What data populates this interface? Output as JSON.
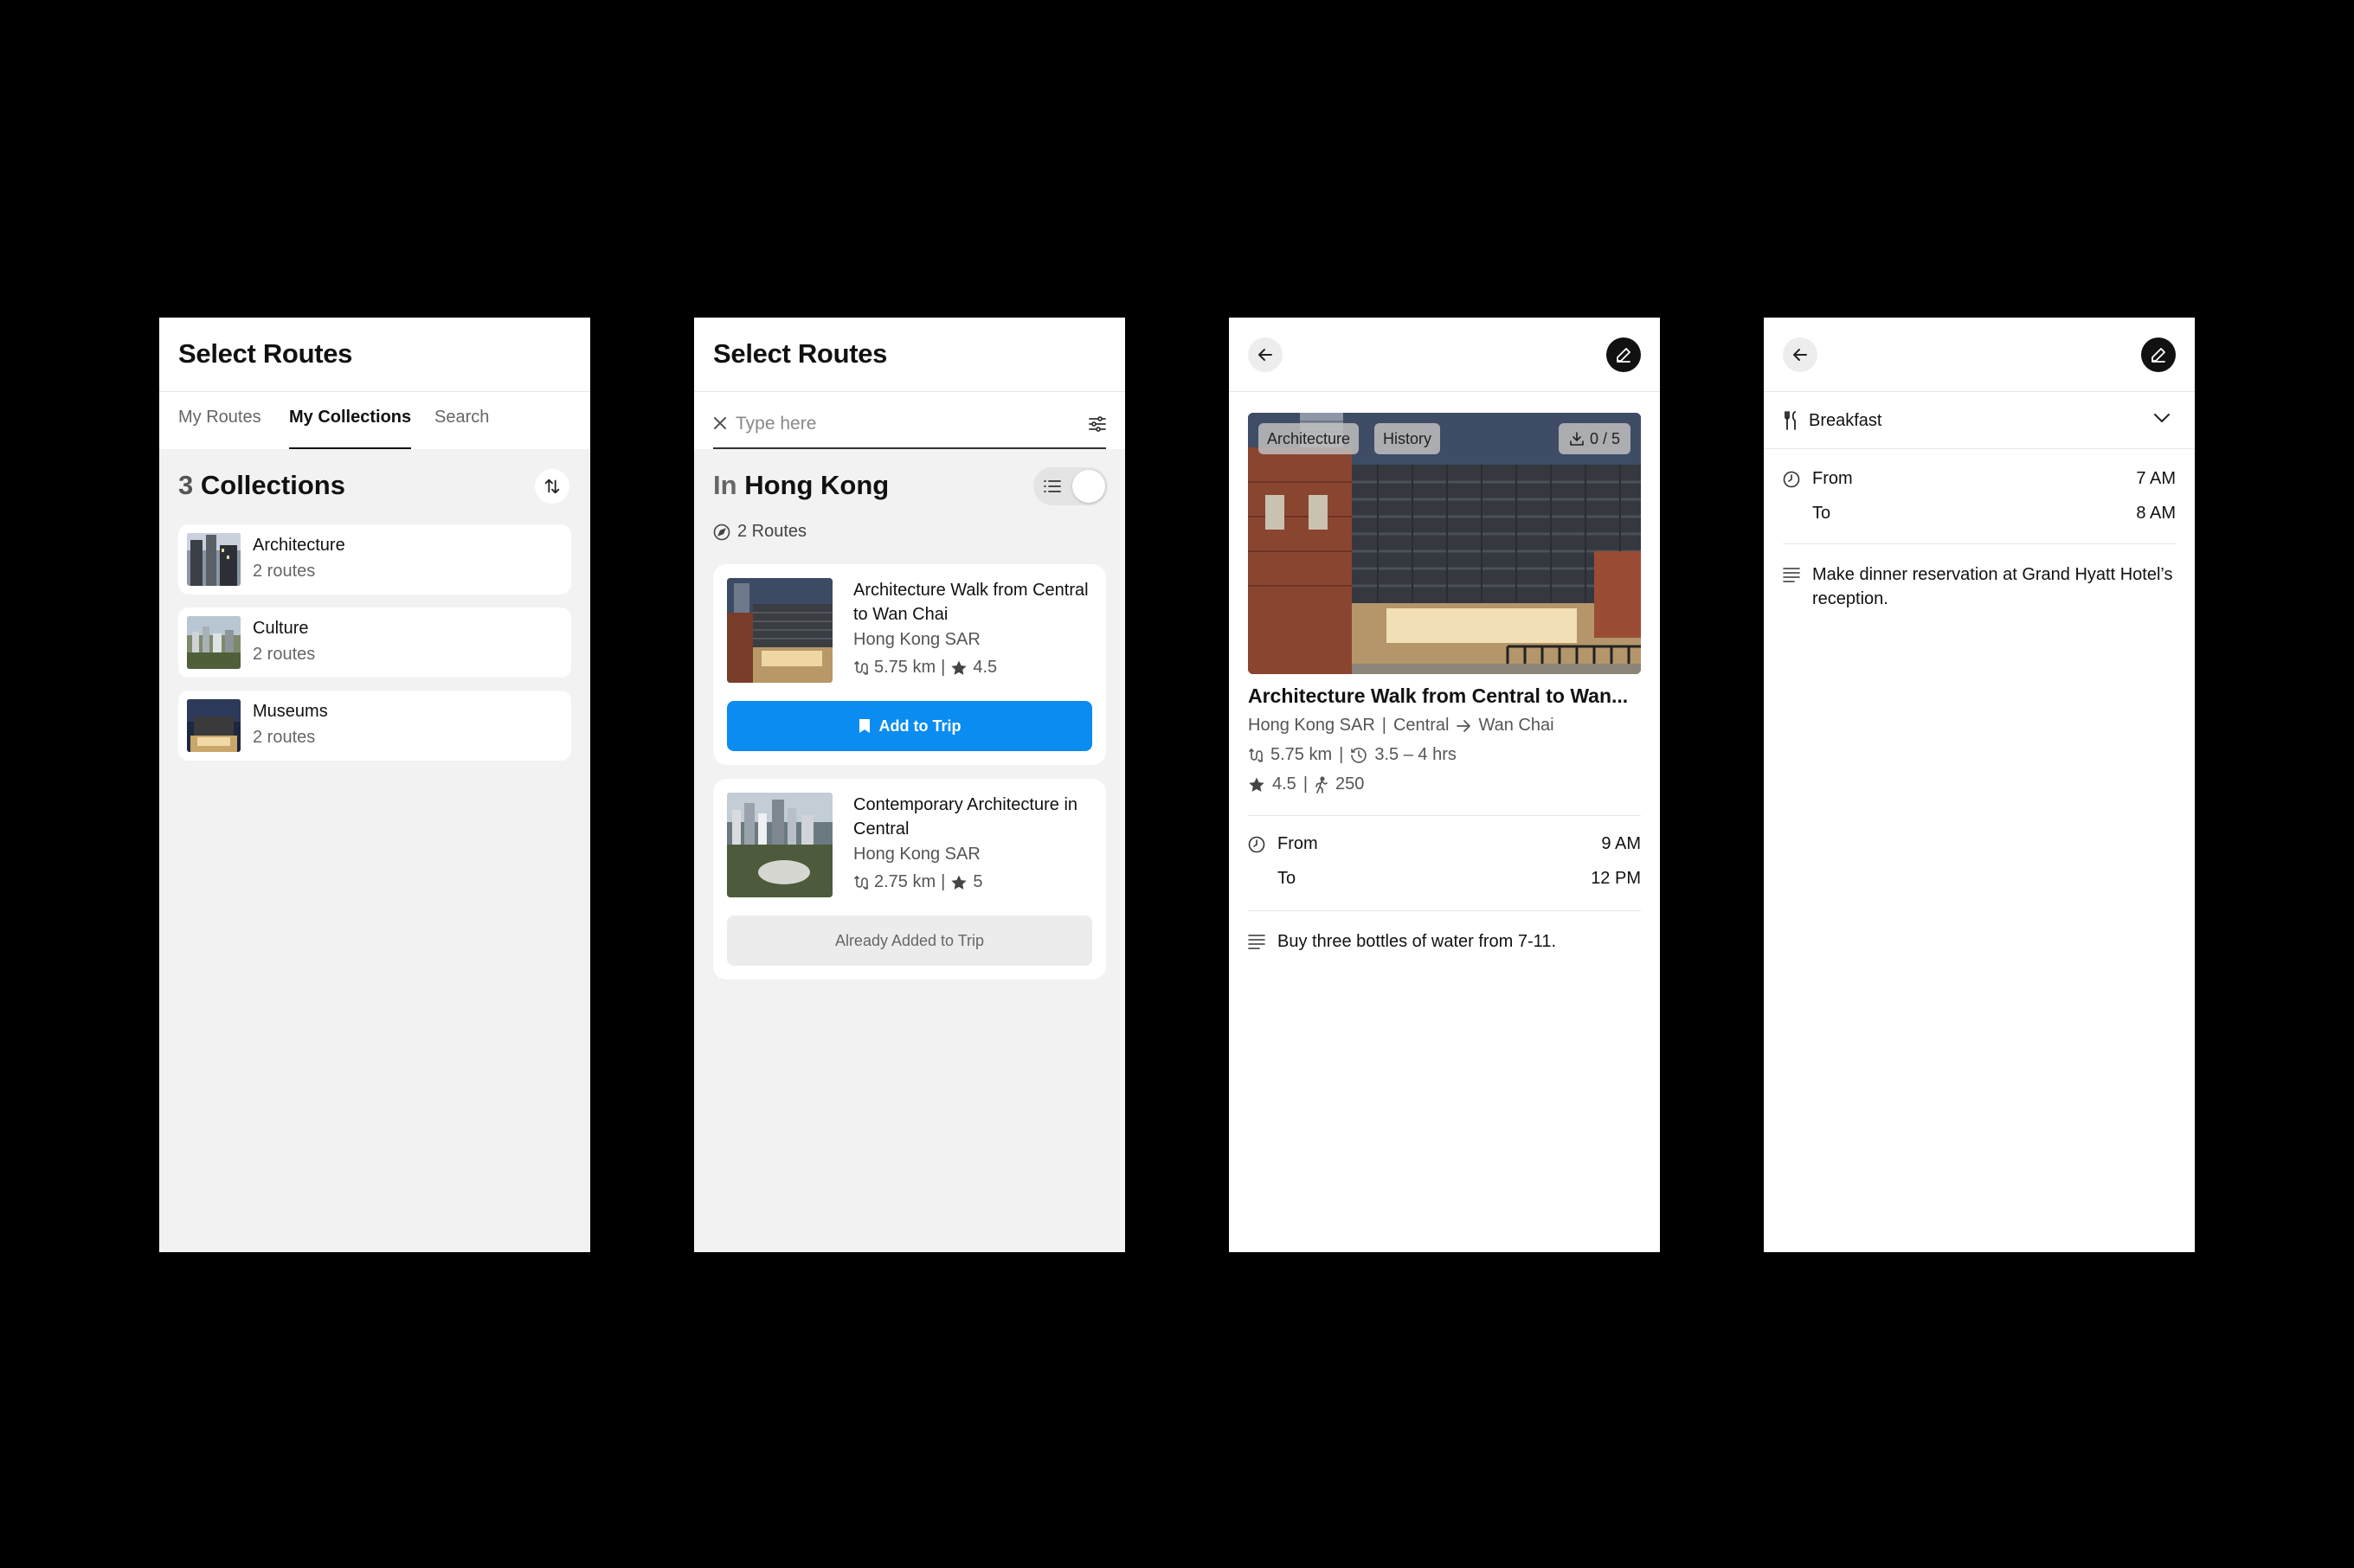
{
  "screen1": {
    "header_title": "Select Routes",
    "tabs": [
      "My Routes",
      "My Collections",
      "Search"
    ],
    "active_tab": "My Collections",
    "section_count": "3",
    "section_label": "Collections",
    "collections": [
      {
        "name": "Architecture",
        "sub": "2 routes"
      },
      {
        "name": "Culture",
        "sub": "2 routes"
      },
      {
        "name": "Museums",
        "sub": "2 routes"
      }
    ]
  },
  "screen2": {
    "header_title": "Select Routes",
    "search_placeholder": "Type here",
    "location_prefix": "In",
    "location": "Hong Kong",
    "routes_count": "2 Routes",
    "routes": [
      {
        "title": "Architecture Walk from Central to Wan Chai",
        "location": "Hong Kong SAR",
        "distance": "5.75 km",
        "rating": "4.5",
        "action": "Add to Trip"
      },
      {
        "title": "Contemporary Architecture in Central",
        "location": "Hong Kong SAR",
        "distance": "2.75 km",
        "rating": "5",
        "action": "Already Added to Trip"
      }
    ]
  },
  "screen3": {
    "tags": [
      "Architecture",
      "History"
    ],
    "save_count": "0 / 5",
    "title": "Architecture Walk from Central to Wan...",
    "location": "Hong Kong SAR",
    "from_place": "Central",
    "to_place": "Wan Chai",
    "distance": "5.75 km",
    "duration": "3.5 – 4 hrs",
    "rating": "4.5",
    "walkers": "250",
    "from_label": "From",
    "from_time": "9 AM",
    "to_label": "To",
    "to_time": "12 PM",
    "note": "Buy three bottles of water from 7-11."
  },
  "screen4": {
    "meal": "Breakfast",
    "from_label": "From",
    "from_time": "7 AM",
    "to_label": "To",
    "to_time": "8 AM",
    "note": "Make dinner reservation at Grand Hyatt Hotel’s reception."
  },
  "colors": {
    "background": "#000000",
    "screen_gray": "#f2f2f2",
    "accent_blue": "#0a8cf0",
    "text_primary": "#111111",
    "text_secondary": "#555555"
  },
  "icons": [
    "sort-icon",
    "close-icon",
    "filter-icon",
    "list-view-icon",
    "compass-icon",
    "route-icon",
    "star-icon",
    "bookmark-icon",
    "back-arrow-icon",
    "edit-icon",
    "save-icon",
    "clock-icon",
    "walker-icon",
    "arrow-right-icon",
    "notes-icon",
    "cutlery-icon",
    "chevron-down-icon"
  ]
}
